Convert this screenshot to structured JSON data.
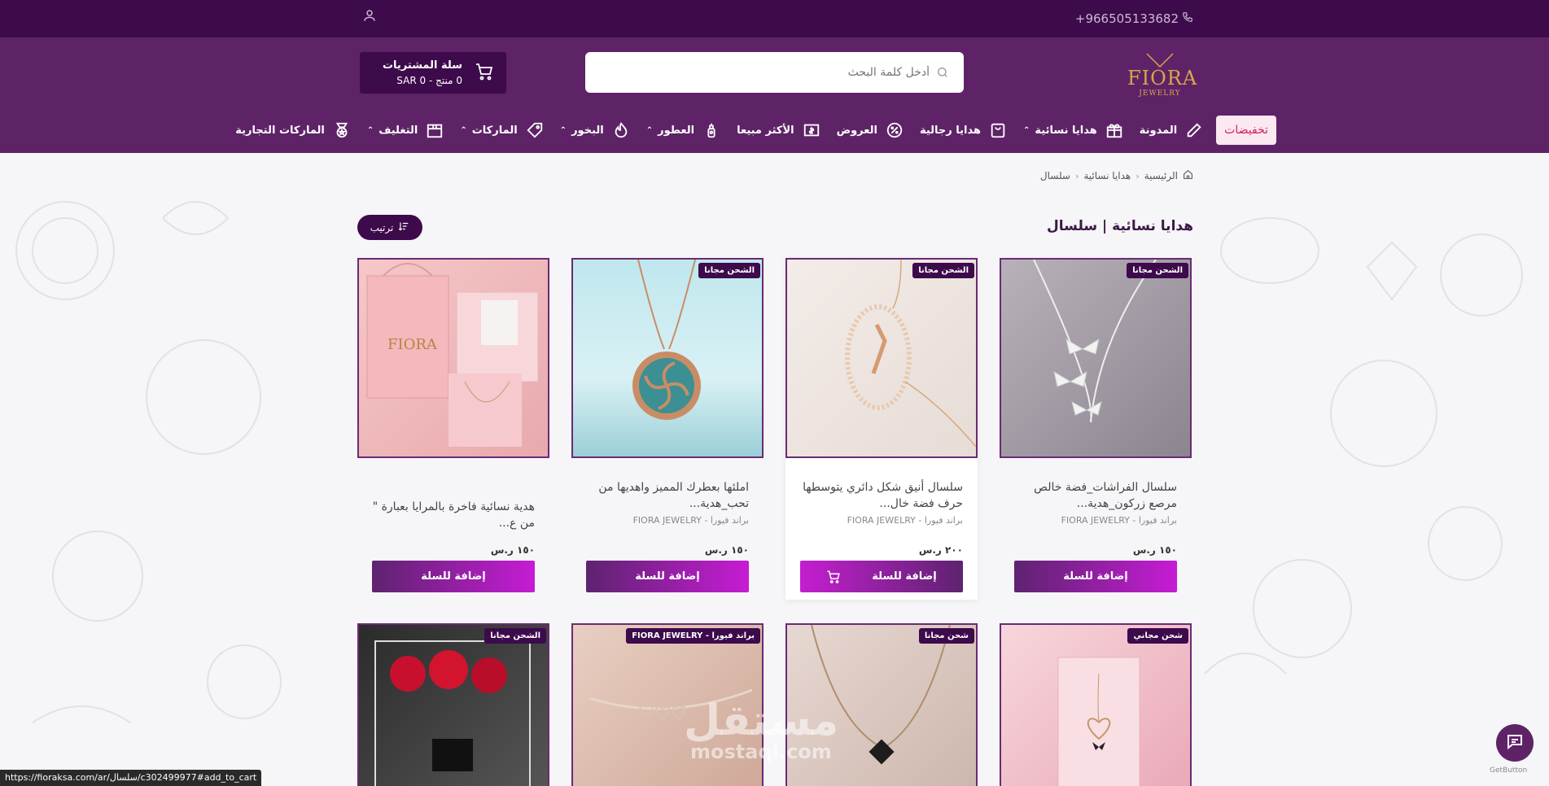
{
  "topbar": {
    "phone": "+966505133682"
  },
  "logo": {
    "word": "FIORA",
    "sub": "JEWELRY"
  },
  "search": {
    "placeholder": "أدخل كلمة البحث"
  },
  "cart": {
    "title": "سلة المشتريات",
    "summary": "0 منتج - 0 SAR"
  },
  "nav": {
    "sale": "تخفيضات",
    "items": [
      {
        "label": "المدونة",
        "icon": "pencil-icon",
        "caret": false
      },
      {
        "label": "هدايا نسائية",
        "icon": "gift-icon",
        "caret": true
      },
      {
        "label": "هدايا رجالية",
        "icon": "bag-icon",
        "caret": false
      },
      {
        "label": "العروض",
        "icon": "percent-badge-icon",
        "caret": false
      },
      {
        "label": "الأكثر مبيعا",
        "icon": "money-icon",
        "caret": false
      },
      {
        "label": "العطور",
        "icon": "perfume-icon",
        "caret": true
      },
      {
        "label": "البخور",
        "icon": "flame-icon",
        "caret": true
      },
      {
        "label": "الماركات",
        "icon": "tag-icon",
        "caret": true
      },
      {
        "label": "التغليف",
        "icon": "box-icon",
        "caret": true
      },
      {
        "label": "الماركات التجارية",
        "icon": "medal-icon",
        "caret": false
      }
    ]
  },
  "breadcrumb": {
    "home": "الرئيسية",
    "level1": "هدايا نسائية",
    "level2": "سلسال"
  },
  "page": {
    "title": "هدايا نسائية | سلسال",
    "sort_label": "ترتيب"
  },
  "products": [
    {
      "badge": "الشحن مجانا",
      "title": "سلسال الفراشات_فضة خالص مرصع زركون_هدية...",
      "brand": "براند فيورا - FIORA JEWELRY",
      "price": "١٥٠ ر.س",
      "button": "إضافة للسلة"
    },
    {
      "badge": "الشحن مجانا",
      "title": "سلسال أنيق شكل دائري يتوسطها حرف فضة خال...",
      "brand": "براند فيورا - FIORA JEWELRY",
      "price": "٢٠٠ ر.س",
      "button": "إضافة للسلة"
    },
    {
      "badge": "الشحن مجانا",
      "title": "املئها بعطرك المميز واهديها من تحب_هدية...",
      "brand": "براند فيورا - FIORA JEWELRY",
      "price": "١٥٠ ر.س",
      "button": "إضافة للسلة"
    },
    {
      "badge": "",
      "title": "هدية نسائية فاخرة بالمرايا بعبارة \" من ع...",
      "brand": "",
      "price": "١٥٠ ر.س",
      "button": "إضافة للسلة"
    }
  ],
  "products_row2": [
    {
      "badge": "شحن مجاني"
    },
    {
      "badge": "شحن مجانا"
    },
    {
      "badge": "براند فيورا - FIORA JEWELRY"
    },
    {
      "badge": "الشحن مجانا"
    }
  ],
  "status_url": "https://fioraksa.com/ar/سلسال/c302499977#add_to_cart",
  "watermark": {
    "main": "مستقل",
    "sub": "mostaql.com"
  },
  "getbutton": "GetButton",
  "colors": {
    "header": "#5e2367",
    "topbar": "#3d0a4b",
    "accent": "#c61cd4",
    "sale": "#d0215f"
  }
}
